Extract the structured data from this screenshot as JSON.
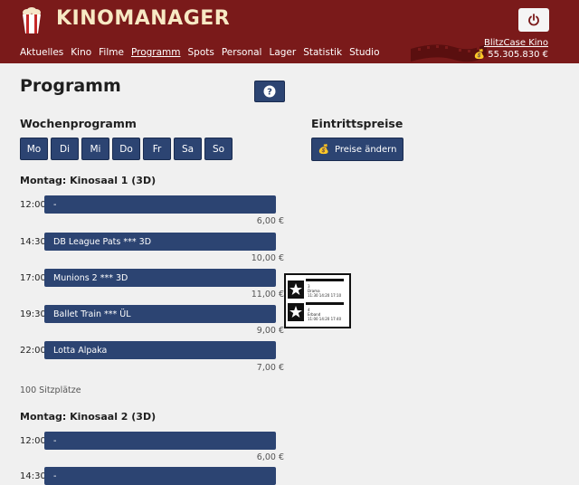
{
  "header": {
    "brand": "KINOMANAGER",
    "cinema_name": "BlitzCase Kino",
    "money": "55.305.830 €",
    "icons": {
      "logo": "popcorn-icon",
      "power": "power-icon",
      "money": "money-bag-icon"
    }
  },
  "nav": [
    {
      "label": "Aktuelles"
    },
    {
      "label": "Kino"
    },
    {
      "label": "Filme"
    },
    {
      "label": "Programm",
      "active": true
    },
    {
      "label": "Spots"
    },
    {
      "label": "Personal"
    },
    {
      "label": "Lager"
    },
    {
      "label": "Statistik"
    },
    {
      "label": "Studio"
    }
  ],
  "page": {
    "title": "Programm",
    "help_icon": "question-icon",
    "week_title": "Wochenprogramm",
    "prices_title": "Eintrittspreise",
    "prices_button": "Preise ändern"
  },
  "days": [
    "Mo",
    "Di",
    "Mi",
    "Do",
    "Fr",
    "Sa",
    "So"
  ],
  "halls": [
    {
      "title": "Montag: Kinosaal 1 (3D)",
      "slots": [
        {
          "time": "12:00",
          "film": "-",
          "price": "6,00 €"
        },
        {
          "time": "14:30",
          "film": "DB League Pats *** 3D",
          "price": "10,00 €"
        },
        {
          "time": "17:00",
          "film": "Munions 2 *** 3D",
          "price": "11,00 €"
        },
        {
          "time": "19:30",
          "film": "Ballet Train *** ÜL",
          "price": "9,00 €"
        },
        {
          "time": "22:00",
          "film": "Lotta Alpaka",
          "price": "7,00 €"
        }
      ],
      "seats": "100 Sitzplätze"
    },
    {
      "title": "Montag: Kinosaal 2 (3D)",
      "slots": [
        {
          "time": "12:00",
          "film": "-",
          "price": "6,00 €"
        },
        {
          "time": "14:30",
          "film": "-",
          "price": ""
        }
      ]
    }
  ],
  "ticket_popup": {
    "rows": [
      {
        "line1": "3",
        "line2": "Drama",
        "times": "11:30 14:20 17:10"
      },
      {
        "line1": "4",
        "line2": "Erband",
        "times": "11:00 14:20 17:40"
      }
    ]
  },
  "colors": {
    "header_bg": "#7a1a1a",
    "brand_text": "#f7e9c4",
    "button_bg": "#2c4472",
    "page_bg": "#f0f0f0"
  }
}
